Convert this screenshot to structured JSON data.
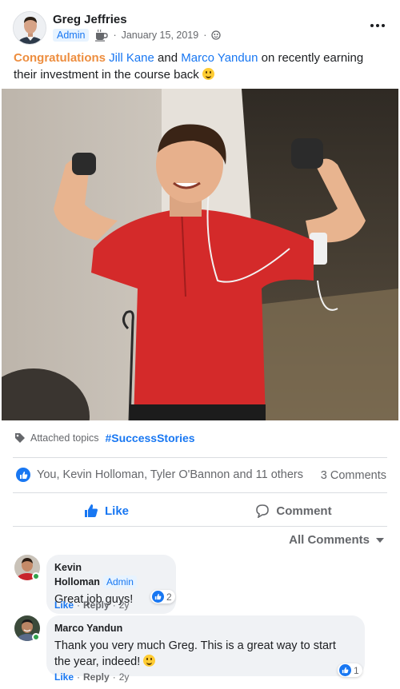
{
  "post": {
    "author": "Greg Jeffries",
    "badge": "Admin",
    "date": "January 15, 2019",
    "text_highlight": "Congratulations",
    "mention_1": "Jill Kane",
    "text_and": "and",
    "mention_2": "Marco Yandun",
    "text_rest": "on recently earning their investment in the course back",
    "icons": {
      "more": "more-dots-icon",
      "cup": "coffee-cup-icon",
      "audience": "globe-icon",
      "emoji": "winking-face-emoji"
    }
  },
  "topics": {
    "label": "Attached topics",
    "tag": "#SuccessStories"
  },
  "reactions": {
    "summary": "You, Kevin Holloman, Tyler O'Bannon and 11 others",
    "comments_count": "3 Comments"
  },
  "actions": {
    "like": "Like",
    "comment": "Comment"
  },
  "comments_filter": "All Comments",
  "comments": [
    {
      "name": "Kevin Holloman",
      "badge": "Admin",
      "text": "Great job guys!",
      "like_label": "Like",
      "reply_label": "Reply",
      "age": "2y",
      "reaction_count": "2"
    },
    {
      "name": "Marco Yandun",
      "text": "Thank you very much Greg. This is a great way to start the year, indeed!",
      "like_label": "Like",
      "reply_label": "Reply",
      "age": "2y",
      "reaction_count": "1"
    }
  ],
  "colors": {
    "accent": "#1877f2",
    "highlight": "#e9710f",
    "muted": "#65676b",
    "shirt": "#d42a2a"
  }
}
